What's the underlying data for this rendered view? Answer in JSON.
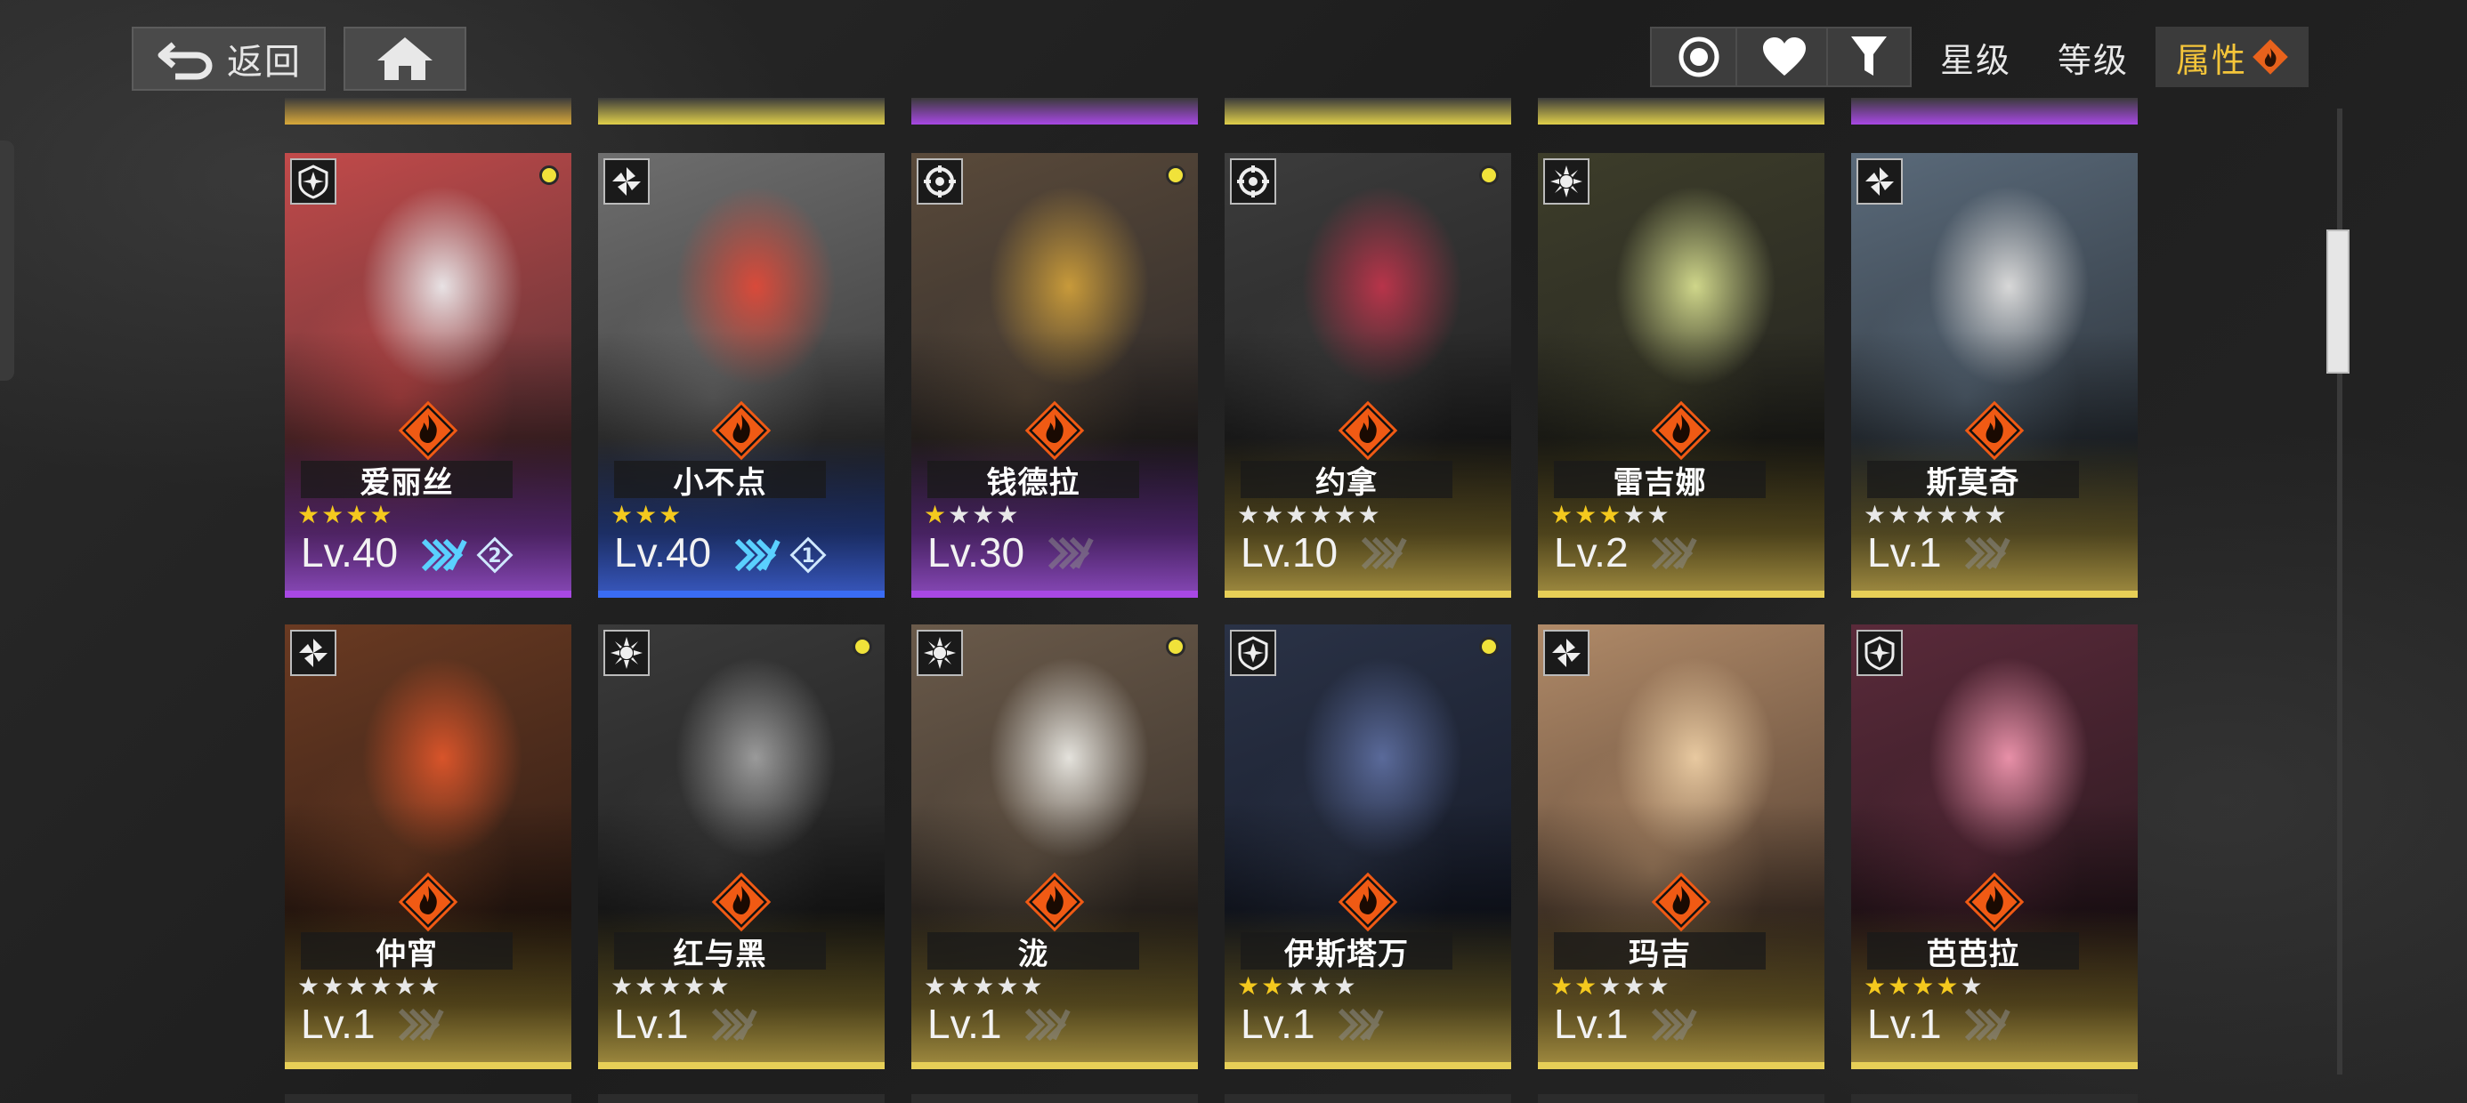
{
  "topbar": {
    "back_label": "返回",
    "back_icon": "return-arrow-icon",
    "home_icon": "home-icon",
    "filter_circle_icon": "target-circle-icon",
    "favorite_icon": "heart-icon",
    "filter_icon": "funnel-icon",
    "sort_star": "星级",
    "sort_level": "等级",
    "sort_attr": "属性",
    "sort_attr_active_color": "#f4c53a"
  },
  "cards": [
    {
      "name": "爱丽丝",
      "stars_on": 4,
      "stars_total": 4,
      "level": "Lv.40",
      "rarity": "purple",
      "class_icon": "shield-burst-icon",
      "dot": true,
      "neural": "2",
      "palette": [
        "#e8e2e4",
        "#c24a4a",
        "#3a2b30"
      ]
    },
    {
      "name": "小不点",
      "stars_on": 3,
      "stars_total": 3,
      "level": "Lv.40",
      "rarity": "blue",
      "class_icon": "pinwheel-icon",
      "dot": false,
      "neural": "1",
      "palette": [
        "#d94a3a",
        "#6e6e6e",
        "#2c2c2c"
      ]
    },
    {
      "name": "钱德拉",
      "stars_on": 1,
      "stars_total": 4,
      "level": "Lv.30",
      "rarity": "purple",
      "class_icon": "crosshair-icon",
      "dot": true,
      "neural": "",
      "palette": [
        "#c89a3a",
        "#5a4a3a",
        "#1f1f24"
      ]
    },
    {
      "name": "约拿",
      "stars_on": 0,
      "stars_total": 6,
      "level": "Lv.10",
      "rarity": "gold",
      "class_icon": "crosshair-icon",
      "dot": true,
      "neural": "",
      "palette": [
        "#b8344a",
        "#3c3c3c",
        "#1a1a1a"
      ]
    },
    {
      "name": "雷吉娜",
      "stars_on": 3,
      "stars_total": 5,
      "level": "Lv.2",
      "rarity": "gold",
      "class_icon": "gear-burst-icon",
      "dot": false,
      "neural": "",
      "palette": [
        "#cfd68a",
        "#3d3d2a",
        "#1d1d1d"
      ]
    },
    {
      "name": "斯莫奇",
      "stars_on": 0,
      "stars_total": 6,
      "level": "Lv.1",
      "rarity": "gold",
      "class_icon": "pinwheel-icon",
      "dot": false,
      "neural": "",
      "palette": [
        "#d8d8d8",
        "#5a6a7a",
        "#1f2328"
      ]
    },
    {
      "name": "仲宵",
      "stars_on": 0,
      "stars_total": 6,
      "level": "Lv.1",
      "rarity": "gold",
      "class_icon": "pinwheel-icon",
      "dot": false,
      "neural": "",
      "palette": [
        "#d8542a",
        "#6a3a22",
        "#1f1512"
      ]
    },
    {
      "name": "红与黑",
      "stars_on": 0,
      "stars_total": 5,
      "level": "Lv.1",
      "rarity": "gold",
      "class_icon": "gear-burst-icon",
      "dot": true,
      "neural": "",
      "palette": [
        "#9a9a9a",
        "#3a3a3a",
        "#161616"
      ]
    },
    {
      "name": "泷",
      "stars_on": 0,
      "stars_total": 5,
      "level": "Lv.1",
      "rarity": "gold",
      "class_icon": "gear-burst-icon",
      "dot": true,
      "neural": "",
      "palette": [
        "#e4e2dc",
        "#6a5a4a",
        "#2a2420"
      ]
    },
    {
      "name": "伊斯塔万",
      "stars_on": 2,
      "stars_total": 5,
      "level": "Lv.1",
      "rarity": "gold",
      "class_icon": "shield-burst-icon",
      "dot": true,
      "neural": "",
      "palette": [
        "#5a6a9a",
        "#2a3246",
        "#101420"
      ]
    },
    {
      "name": "玛吉",
      "stars_on": 2,
      "stars_total": 5,
      "level": "Lv.1",
      "rarity": "gold",
      "class_icon": "pinwheel-icon",
      "dot": false,
      "neural": "",
      "palette": [
        "#e8c9a0",
        "#b08a68",
        "#3a2a22"
      ]
    },
    {
      "name": "芭芭拉",
      "stars_on": 4,
      "stars_total": 5,
      "level": "Lv.1",
      "rarity": "gold",
      "class_icon": "shield-burst-icon",
      "dot": false,
      "neural": "",
      "palette": [
        "#e890a8",
        "#5a2a3a",
        "#1e1418"
      ]
    }
  ],
  "peek_rows": {
    "top_colors": [
      "#d9a93a",
      "#e0cf4a",
      "#a848e4",
      "#e0cf4a",
      "#e0cf4a",
      "#a848e4"
    ]
  },
  "colors": {
    "element_fire": "#f05a14",
    "star_on": "#f4c91e",
    "accent_dot": "#f0e23a"
  }
}
